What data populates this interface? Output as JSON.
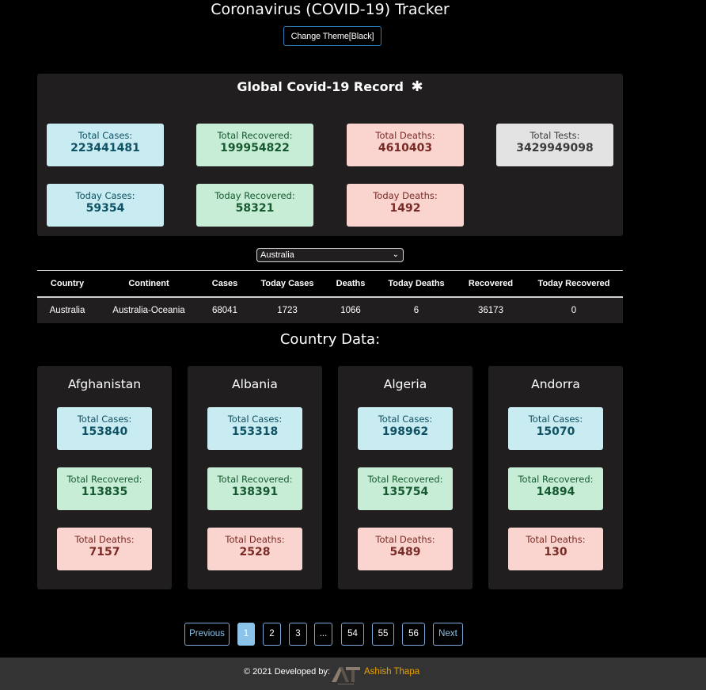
{
  "header": {
    "title": "Coronavirus (COVID-19) Tracker",
    "theme_button": "Change Theme[Black]"
  },
  "global": {
    "title": "Global Covid-19 Record",
    "total_cases_label": "Total Cases:",
    "total_cases": "223441481",
    "total_recovered_label": "Total Recovered:",
    "total_recovered": "199954822",
    "total_deaths_label": "Total Deaths:",
    "total_deaths": "4610403",
    "total_tests_label": "Total Tests:",
    "total_tests": "3429949098",
    "today_cases_label": "Today Cases:",
    "today_cases": "59354",
    "today_recovered_label": "Today Recovered:",
    "today_recovered": "58321",
    "today_deaths_label": "Today Deaths:",
    "today_deaths": "1492"
  },
  "selector": {
    "selected": "Australia"
  },
  "table": {
    "headers": [
      "Country",
      "Continent",
      "Cases",
      "Today Cases",
      "Deaths",
      "Today Deaths",
      "Recovered",
      "Today Recovered"
    ],
    "row": [
      "Australia",
      "Australia-Oceania",
      "68041",
      "1723",
      "1066",
      "6",
      "36173",
      "0"
    ]
  },
  "countries": {
    "section_title": "Country Data:",
    "labels": {
      "cases": "Total Cases:",
      "recovered": "Total Recovered:",
      "deaths": "Total Deaths:"
    },
    "cards": [
      {
        "name": "Afghanistan",
        "cases": "153840",
        "recovered": "113835",
        "deaths": "7157"
      },
      {
        "name": "Albania",
        "cases": "153318",
        "recovered": "138391",
        "deaths": "2528"
      },
      {
        "name": "Algeria",
        "cases": "198962",
        "recovered": "135754",
        "deaths": "5489"
      },
      {
        "name": "Andorra",
        "cases": "15070",
        "recovered": "14894",
        "deaths": "130"
      }
    ]
  },
  "pagination": {
    "previous": "Previous",
    "pages": [
      "1",
      "2",
      "3",
      "...",
      "54",
      "55",
      "56"
    ],
    "next": "Next",
    "current": "1"
  },
  "footer": {
    "text": "© 2021 Developed by:",
    "author": "Ashish Thapa",
    "logo_icon": "at-logo-icon"
  },
  "colors": {
    "cases": "#c9ebf2",
    "recovered": "#c7edd7",
    "deaths": "#fad5d0",
    "tests": "#e3e3e3",
    "author": "#e8a200"
  }
}
